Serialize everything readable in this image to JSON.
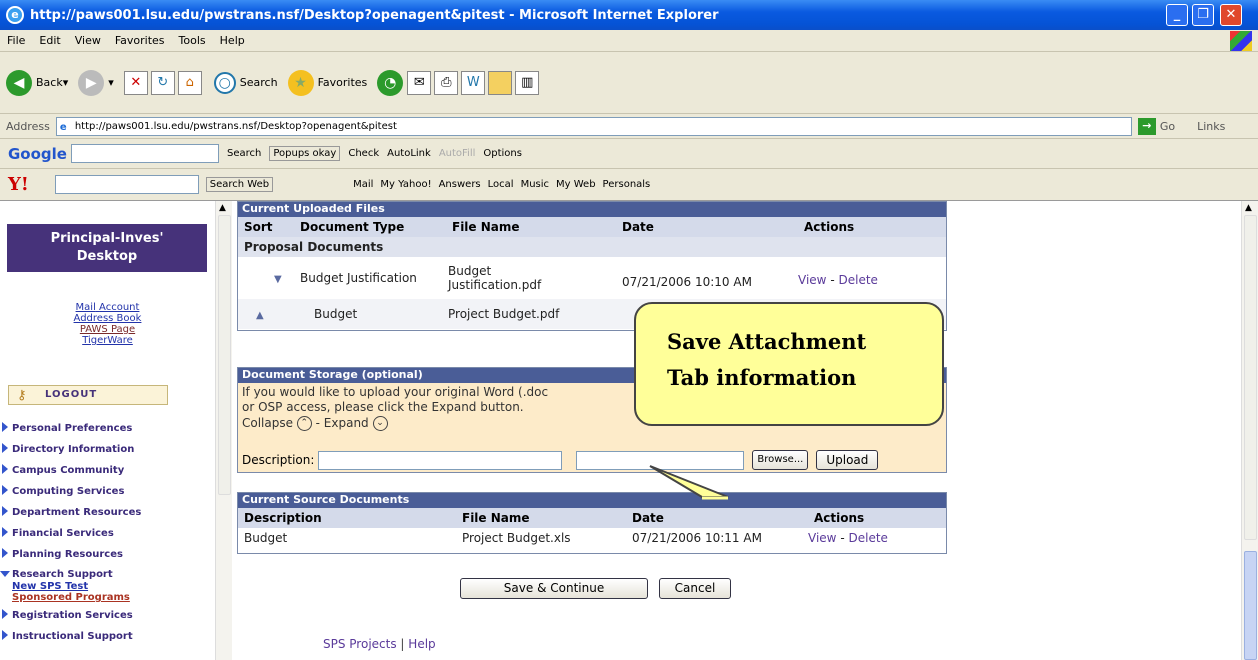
{
  "window": {
    "title": "http://paws001.lsu.edu/pwstrans.nsf/Desktop?openagent&pitest - Microsoft Internet Explorer"
  },
  "menu": [
    "File",
    "Edit",
    "View",
    "Favorites",
    "Tools",
    "Help"
  ],
  "toolbar": {
    "back": "Back",
    "search": "Search",
    "favorites": "Favorites"
  },
  "address": {
    "label": "Address",
    "url": "http://paws001.lsu.edu/pwstrans.nsf/Desktop?openagent&pitest",
    "go": "Go",
    "links": "Links"
  },
  "google": {
    "logo": "Google",
    "search": "Search",
    "popups": "Popups okay",
    "check": "Check",
    "autolink": "AutoLink",
    "autofill": "AutoFill",
    "options": "Options"
  },
  "yahoo": {
    "logo": "Y!",
    "searchweb": "Search Web",
    "mail": "Mail",
    "myyahoo": "My Yahoo!",
    "answers": "Answers",
    "local": "Local",
    "music": "Music",
    "myweb": "My Web",
    "personals": "Personals"
  },
  "left": {
    "banner1": "Principal-Inves'",
    "banner2": "Desktop",
    "mail": "Mail",
    "account": "Account",
    "addressbook": "Address Book",
    "pawspage": "PAWS Page",
    "tigerware": "TigerWare",
    "logout": "LOGOUT",
    "nav": [
      "Personal Preferences",
      "Directory Information",
      "Campus Community",
      "Computing Services",
      "Department Resources",
      "Financial Services",
      "Planning Resources",
      "Research Support"
    ],
    "sub1": "New SPS Test",
    "sub2": "Sponsored Programs",
    "nav2": [
      "Registration Services",
      "Instructional Support"
    ]
  },
  "uploaded": {
    "heading": "Current Uploaded Files",
    "cols": [
      "Sort",
      "Document Type",
      "File Name",
      "Date",
      "Actions"
    ],
    "group": "Proposal Documents",
    "rows": [
      {
        "type": "Budget Justification",
        "file1": "Budget",
        "file2": "Justification.pdf",
        "date": "07/21/2006 10:10 AM",
        "view": "View",
        "sep": "-",
        "del": "Delete"
      },
      {
        "type": "Budget",
        "file1": "Project Budget.pdf"
      }
    ]
  },
  "storage": {
    "heading": "Document Storage (optional)",
    "line1": "If you would like to upload your original Word (.doc",
    "line2": "or OSP access, please click the Expand button.",
    "collapse": "Collapse",
    "sep": "- Expand",
    "desc": "Description:",
    "browse": "Browse...",
    "upload": "Upload"
  },
  "source": {
    "heading": "Current Source Documents",
    "cols": [
      "Description",
      "File Name",
      "Date",
      "Actions"
    ],
    "row": {
      "desc": "Budget",
      "file": "Project Budget.xls",
      "date": "07/21/2006 10:11 AM",
      "view": "View",
      "sep": "-",
      "del": "Delete"
    }
  },
  "buttons": {
    "save": "Save & Continue",
    "cancel": "Cancel"
  },
  "footer": {
    "projects": "SPS Projects",
    "sep": "|",
    "help": "Help"
  },
  "callout": {
    "line1": "Save Attachment",
    "line2": "Tab information"
  },
  "colors": {
    "titlebar": "#0553d6",
    "panelhead": "#4a5d97",
    "banner": "#46327a",
    "storagebg": "#fdebc9",
    "callout": "#ffff99"
  }
}
